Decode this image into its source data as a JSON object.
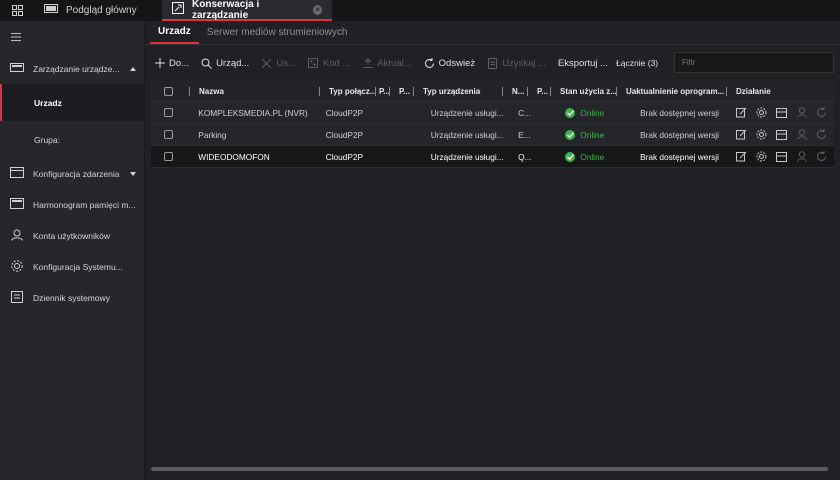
{
  "tabs": [
    {
      "label": "Podgląd główny",
      "icon": "monitor-icon",
      "active": false
    },
    {
      "label": "Konserwacja i zarządzanie",
      "icon": "maintenance-icon",
      "active": true
    }
  ],
  "sidebar": {
    "items": [
      {
        "label": "Zarządzanie urządze...",
        "icon": "device-management-icon",
        "expanded": true,
        "children": [
          {
            "label": "Urzadz",
            "active": true
          },
          {
            "label": "Grupa:",
            "active": false
          }
        ]
      },
      {
        "label": "Konfiguracja zdarzenia",
        "icon": "event-config-icon",
        "expanded": false
      },
      {
        "label": "Harmonogram pamięci m...",
        "icon": "storage-schedule-icon"
      },
      {
        "label": "Konta użytkowników",
        "icon": "user-accounts-icon"
      },
      {
        "label": "Konfiguracja Systemu...",
        "icon": "system-config-icon"
      },
      {
        "label": "Dziennik systemowy",
        "icon": "system-log-icon"
      }
    ]
  },
  "subtabs": [
    {
      "label": "Urzadz",
      "active": true
    },
    {
      "label": "Serwer mediów strumieniowych",
      "active": false
    }
  ],
  "toolbar": {
    "add": "Do...",
    "search": "Urząd...",
    "delete": "Us...",
    "qr": "Kod ...",
    "update": "Aktual...",
    "refresh": "Odswież",
    "obtain": "Uzyskaj ...",
    "export": "Eksportuj ...",
    "total": "Łącznie (3)",
    "filter_placeholder": "Filtr"
  },
  "table": {
    "headers": {
      "name": "Nazwa",
      "conn": "Typ połącz...",
      "p1": "P...",
      "p2": "P...",
      "type": "Typ urządzenia",
      "n": "N...",
      "p3": "P...",
      "status": "Stan użycia z...",
      "firmware": "Uaktualnienie oprogram...",
      "action": "Działanie"
    },
    "rows": [
      {
        "name": "KOMPLEKSMEDIA.PL (NVR)",
        "conn": "CloudP2P",
        "type": "Urządzenie usługi...",
        "n": "C...",
        "status": "Online",
        "firmware": "Brak dostępnej wersji",
        "selected": false
      },
      {
        "name": "Parking",
        "conn": "CloudP2P",
        "type": "Urządzenie usługi...",
        "n": "E...",
        "status": "Online",
        "firmware": "Brak dostępnej wersji",
        "selected": false
      },
      {
        "name": "WIDEODOMOFON",
        "conn": "CloudP2P",
        "type": "Urządzenie usługi...",
        "n": "Q...",
        "status": "Online",
        "firmware": "Brak dostępnej wersji",
        "selected": true
      }
    ]
  },
  "colors": {
    "accent": "#e0313d",
    "online": "#39b54a"
  }
}
